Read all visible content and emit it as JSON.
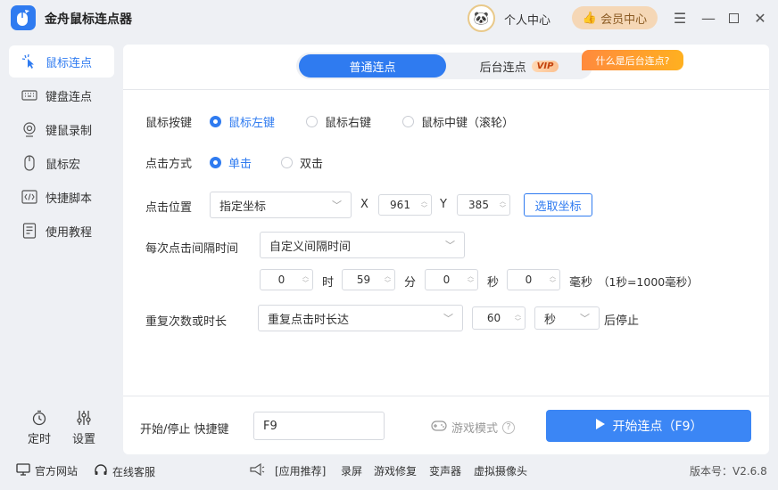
{
  "app": {
    "title": "金舟鼠标连点器"
  },
  "header": {
    "user_center": "个人中心",
    "vip_center": "会员中心"
  },
  "sidebar": {
    "items": [
      {
        "label": "鼠标连点",
        "icon": "cursor-click-icon",
        "active": true
      },
      {
        "label": "键盘连点",
        "icon": "keyboard-icon",
        "active": false
      },
      {
        "label": "键鼠录制",
        "icon": "record-icon",
        "active": false
      },
      {
        "label": "鼠标宏",
        "icon": "mouse-icon",
        "active": false
      },
      {
        "label": "快捷脚本",
        "icon": "code-icon",
        "active": false
      },
      {
        "label": "使用教程",
        "icon": "document-icon",
        "active": false
      }
    ],
    "timer": "定时",
    "settings": "设置"
  },
  "tabs": {
    "normal": "普通连点",
    "background": "后台连点",
    "vip_tag": "VIP",
    "bubble": "什么是后台连点?"
  },
  "form": {
    "mouse_button": {
      "label": "鼠标按键",
      "options": [
        "鼠标左键",
        "鼠标右键",
        "鼠标中键（滚轮）"
      ],
      "selected": "鼠标左键"
    },
    "click_mode": {
      "label": "点击方式",
      "options": [
        "单击",
        "双击"
      ],
      "selected": "单击"
    },
    "click_position": {
      "label": "点击位置",
      "mode": "指定坐标",
      "x_label": "X",
      "x": "961",
      "y_label": "Y",
      "y": "385",
      "pick_button": "选取坐标"
    },
    "interval": {
      "label": "每次点击间隔时间",
      "mode": "自定义间隔时间",
      "hours": "0",
      "hours_unit": "时",
      "minutes": "59",
      "minutes_unit": "分",
      "seconds": "0",
      "seconds_unit": "秒",
      "ms": "0",
      "ms_unit": "毫秒",
      "ms_note": "（1秒=1000毫秒）"
    },
    "repeat": {
      "label": "重复次数或时长",
      "mode": "重复点击时长达",
      "value": "60",
      "unit": "秒",
      "suffix": "后停止"
    }
  },
  "bottom": {
    "hotkey_label": "开始/停止 快捷键",
    "hotkey_value": "F9",
    "game_mode": "游戏模式",
    "start_button": "开始连点（F9）"
  },
  "footer": {
    "website": "官方网站",
    "support": "在线客服",
    "recommend": "[应用推荐]",
    "links": [
      "录屏",
      "游戏修复",
      "变声器",
      "虚拟摄像头"
    ],
    "version": "版本号：V2.6.8"
  },
  "colors": {
    "accent": "#2f7bf0",
    "bubble": "#ff8a3d",
    "vip_bg": "#f5d7b6"
  }
}
